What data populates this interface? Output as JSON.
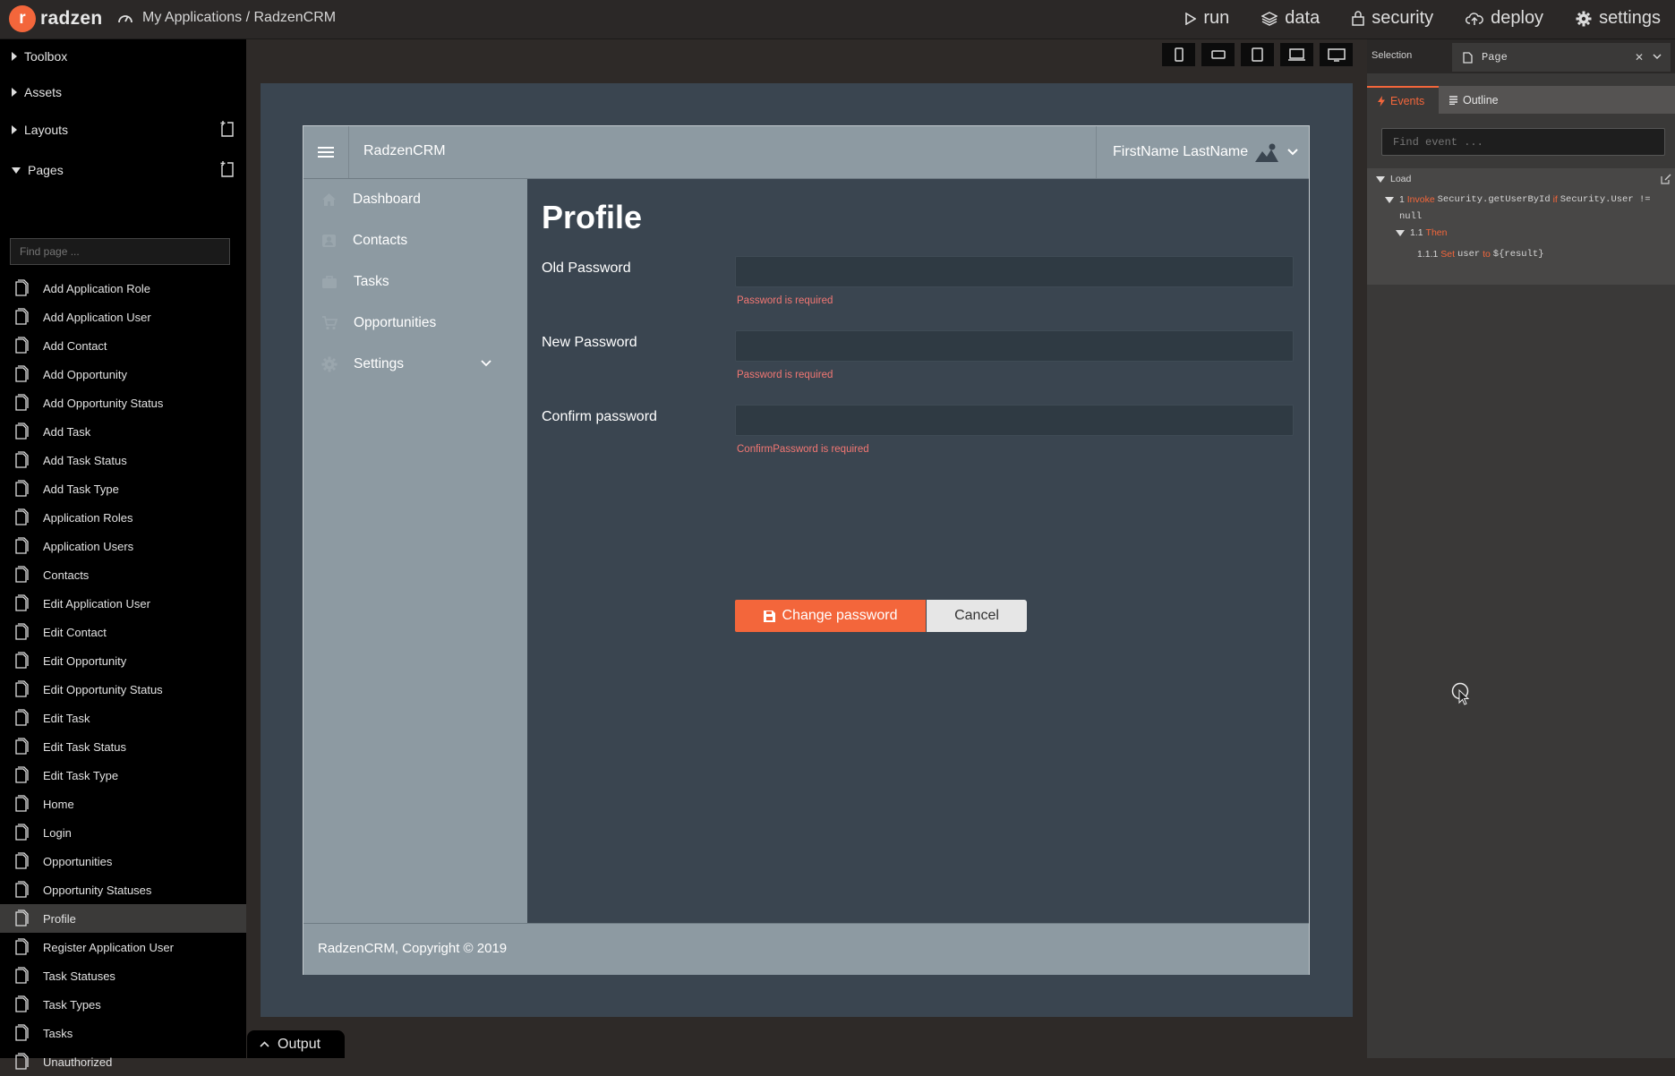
{
  "topbar": {
    "logo_letter": "r",
    "logo_text": "radzen",
    "breadcrumb": "My Applications / RadzenCRM",
    "nav": [
      {
        "label": "run",
        "icon": "play-icon"
      },
      {
        "label": "data",
        "icon": "layers-icon"
      },
      {
        "label": "security",
        "icon": "lock-icon"
      },
      {
        "label": "deploy",
        "icon": "cloud-upload-icon"
      },
      {
        "label": "settings",
        "icon": "gear-icon"
      }
    ]
  },
  "left_panel": {
    "sections": {
      "toolbox": "Toolbox",
      "assets": "Assets",
      "layouts": "Layouts",
      "pages": "Pages"
    },
    "find_page_placeholder": "Find page ...",
    "pages": [
      "Add Application Role",
      "Add Application User",
      "Add Contact",
      "Add Opportunity",
      "Add Opportunity Status",
      "Add Task",
      "Add Task Status",
      "Add Task Type",
      "Application Roles",
      "Application Users",
      "Contacts",
      "Edit Application User",
      "Edit Contact",
      "Edit Opportunity",
      "Edit Opportunity Status",
      "Edit Task",
      "Edit Task Status",
      "Edit Task Type",
      "Home",
      "Login",
      "Opportunities",
      "Opportunity Statuses",
      "Profile",
      "Register Application User",
      "Task Statuses",
      "Task Types",
      "Tasks",
      "Unauthorized"
    ],
    "selected_page": "Profile"
  },
  "device_bar": [
    "phone-portrait-icon",
    "phone-landscape-icon",
    "tablet-portrait-icon",
    "laptop-icon",
    "desktop-icon"
  ],
  "app": {
    "brand": "RadzenCRM",
    "user_name": "FirstName LastName",
    "nav": [
      {
        "label": "Dashboard",
        "icon": "home-icon"
      },
      {
        "label": "Contacts",
        "icon": "contact-card-icon"
      },
      {
        "label": "Tasks",
        "icon": "briefcase-icon"
      },
      {
        "label": "Opportunities",
        "icon": "cart-icon"
      },
      {
        "label": "Settings",
        "icon": "gear-icon"
      }
    ],
    "page_title": "Profile",
    "form": {
      "old_password_label": "Old Password",
      "old_password_error": "Password is required",
      "new_password_label": "New Password",
      "new_password_error": "Password is required",
      "confirm_password_label": "Confirm password",
      "confirm_password_error": "ConfirmPassword is required",
      "change_button": "Change password",
      "cancel_button": "Cancel"
    },
    "footer": "RadzenCRM, Copyright © 2019"
  },
  "output_tab": "Output",
  "right_panel": {
    "selection_label": "Selection",
    "selection_value": "Page",
    "tabs": {
      "events": "Events",
      "outline": "Outline"
    },
    "find_event_placeholder": "Find event ...",
    "events": {
      "load": "Load",
      "line1_num": "1",
      "line1_kw": "Invoke",
      "line1_expr": "Security.getUserById",
      "line1_if": "if",
      "line1_cond": "Security.User !=",
      "line1_cond2": "null",
      "line2_num": "1.1",
      "line2_kw": "Then",
      "line3_num": "1.1.1",
      "line3_kw": "Set",
      "line3_var": "user",
      "line3_to": "to",
      "line3_val": "${result}"
    }
  },
  "colors": {
    "accent": "#f3663b",
    "app_header": "#8d9aa2",
    "app_body": "#3a4550",
    "error": "#f27773"
  }
}
